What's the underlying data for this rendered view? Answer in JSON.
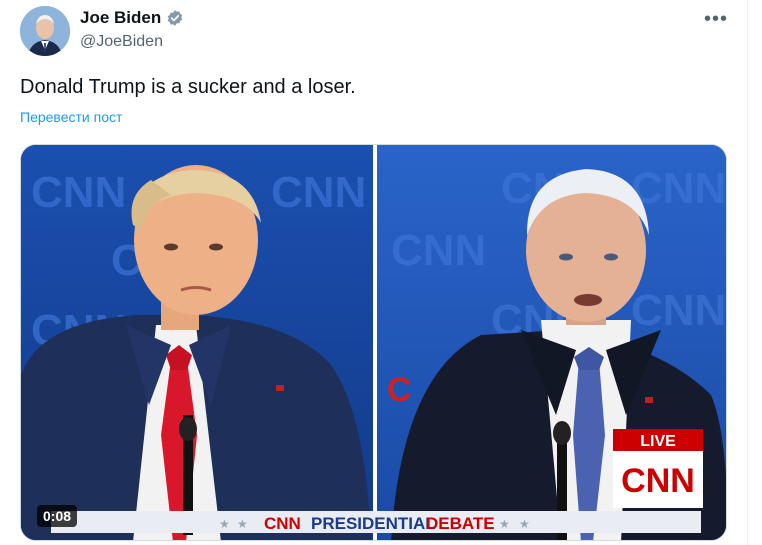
{
  "author": {
    "name": "Joe Biden",
    "handle": "@JoeBiden",
    "verified_icon": "verified-badge-icon",
    "avatar_icon": "avatar-photo"
  },
  "tweet": {
    "text": "Donald Trump is a sucker and a loser.",
    "translate_label": "Перевести пост"
  },
  "more_label": "•••",
  "media": {
    "duration": "0:08",
    "live_label": "LIVE",
    "network_logo": "CNN",
    "banner_network": "CNN",
    "banner_title": "PRESIDENTIAL",
    "banner_subtitle": "DEBATE",
    "watermark": "CNN"
  },
  "colors": {
    "link": "#1d9bf0",
    "verified": "#829aab",
    "cnn_red": "#cc0000",
    "banner_blue": "#1a3a8a"
  }
}
